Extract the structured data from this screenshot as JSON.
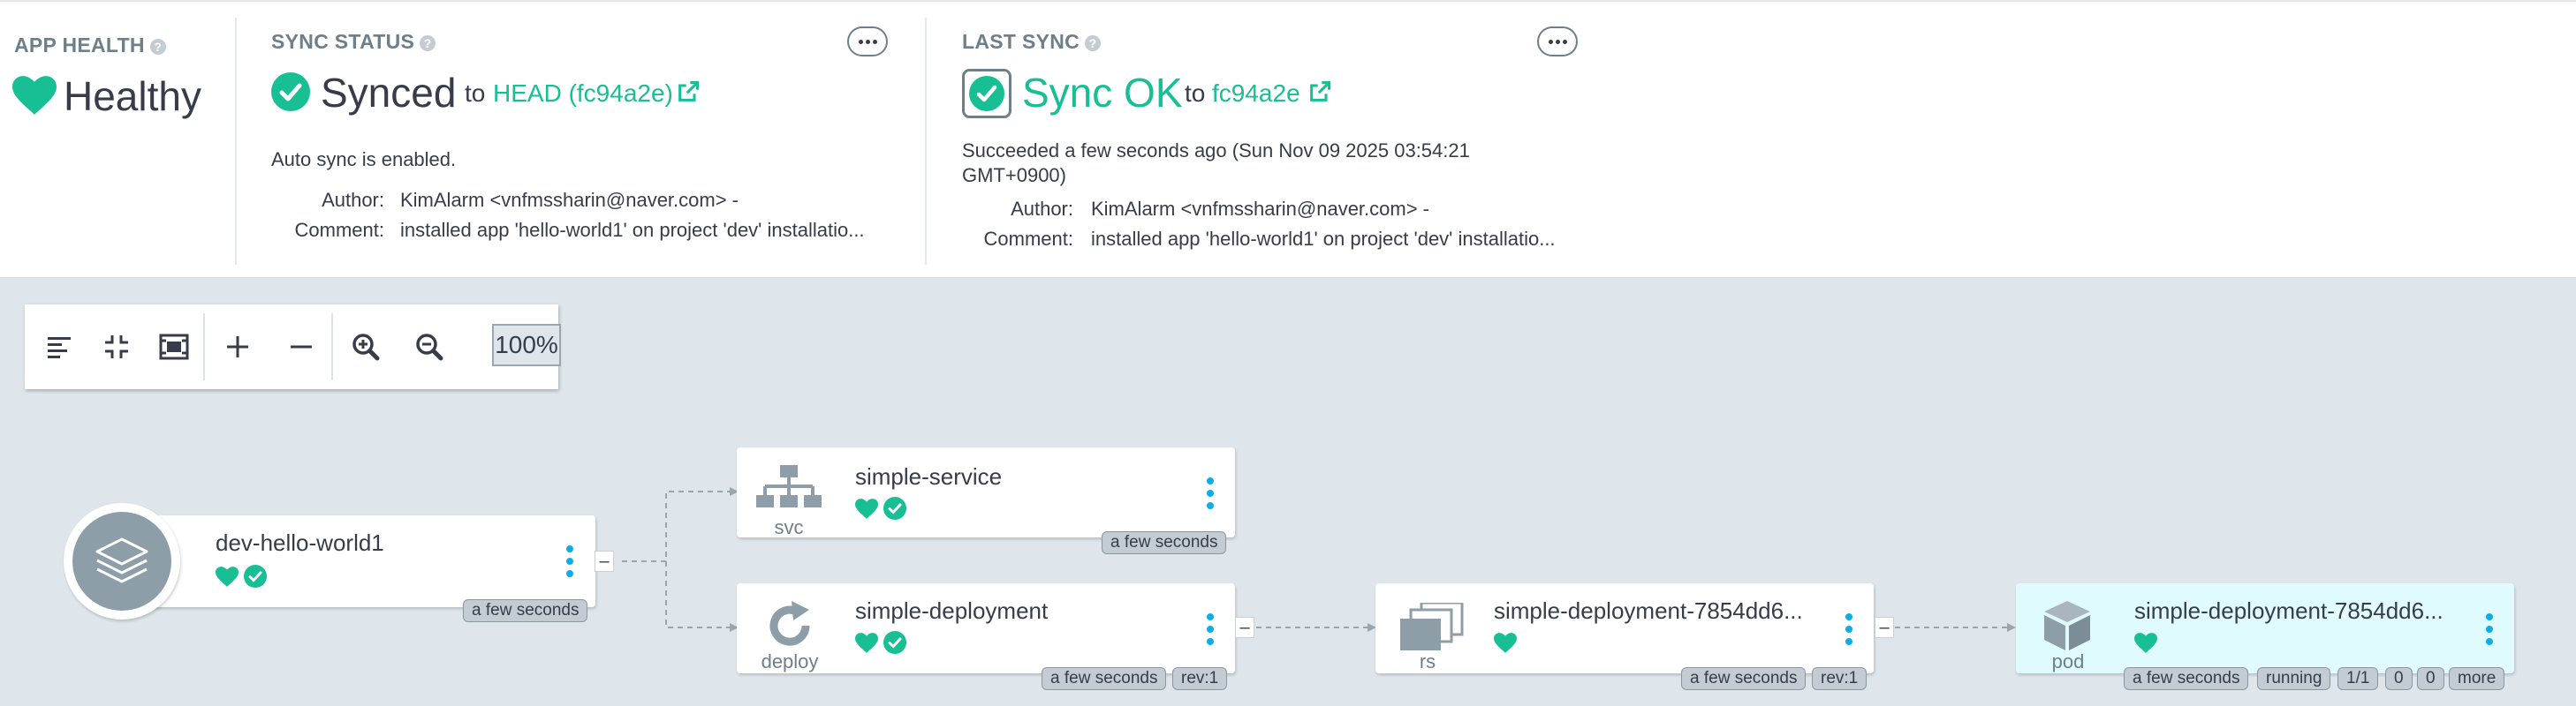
{
  "app_health": {
    "title": "APP HEALTH",
    "status": "Healthy",
    "color": "#18be94"
  },
  "sync_status": {
    "title": "SYNC STATUS",
    "status": "Synced",
    "to": "to",
    "revision": "HEAD (fc94a2e)",
    "auto_sync": "Auto sync is enabled.",
    "author_label": "Author:",
    "author": "KimAlarm <vnfmssharin@naver.com> -",
    "comment_label": "Comment:",
    "comment": "installed app 'hello-world1' on project 'dev' installatio..."
  },
  "last_sync": {
    "title": "LAST SYNC",
    "status": "Sync OK",
    "to": "to",
    "revision": "fc94a2e",
    "succeeded_line1": "Succeeded a few seconds ago (Sun Nov 09 2025 03:54:21",
    "succeeded_line2": "GMT+0900)",
    "author_label": "Author:",
    "author": "KimAlarm <vnfmssharin@naver.com> -",
    "comment_label": "Comment:",
    "comment": "installed app 'hello-world1' on project 'dev' installatio..."
  },
  "toolbar": {
    "zoom": "100%",
    "icons": [
      "align-left-icon",
      "compress-icon",
      "fit-screen-icon",
      "expand-icon",
      "collapse-icon",
      "zoom-in-icon",
      "zoom-out-icon"
    ]
  },
  "nodes": {
    "app": {
      "name": "dev-hello-world1",
      "age": "a few seconds",
      "collapse": "–"
    },
    "service": {
      "name": "simple-service",
      "kind": "svc",
      "age": "a few seconds"
    },
    "deployment": {
      "name": "simple-deployment",
      "kind": "deploy",
      "age": "a few seconds",
      "rev": "rev:1",
      "collapse": "–"
    },
    "replicaset": {
      "name": "simple-deployment-7854dd6...",
      "kind": "rs",
      "age": "a few seconds",
      "rev": "rev:1",
      "collapse": "–"
    },
    "pod": {
      "name": "simple-deployment-7854dd6...",
      "kind": "pod",
      "age": "a few seconds",
      "state": "running",
      "ready": "1/1",
      "restarts": "0",
      "extra": "0",
      "more": "more"
    }
  },
  "colors": {
    "healthy": "#18be94",
    "accent_dots": "#0dadea",
    "pod_bg": "#e0fbfd"
  }
}
